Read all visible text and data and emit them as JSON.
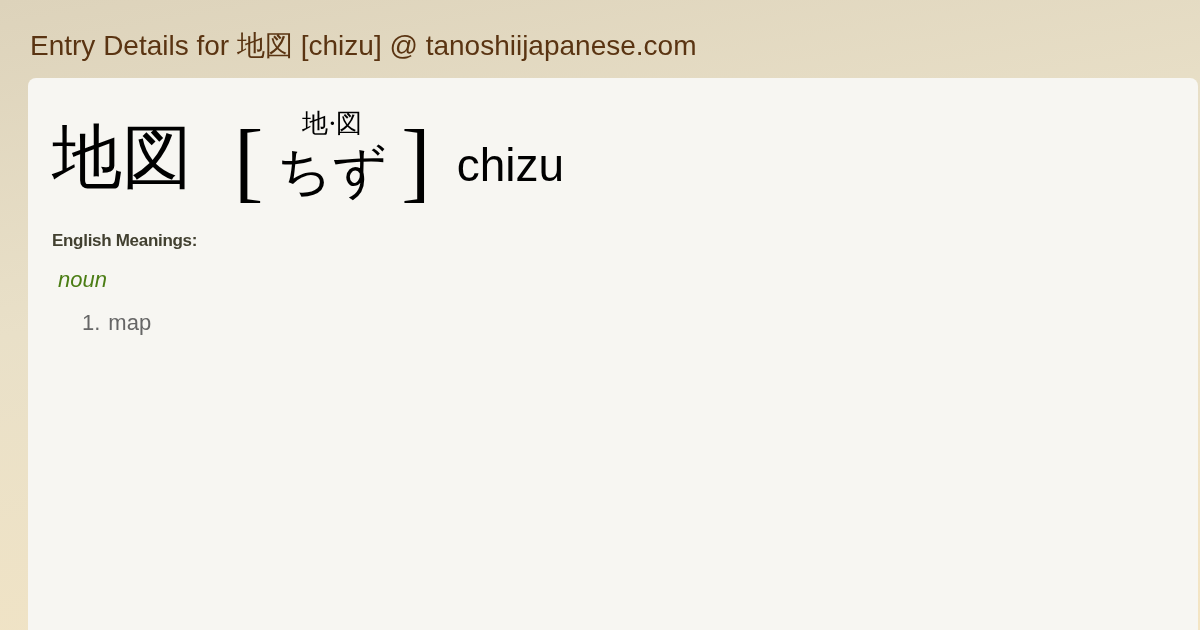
{
  "page_title": "Entry Details for 地図 [chizu] @ tanoshiijapanese.com",
  "entry": {
    "headword": "地図",
    "reading": {
      "bracket_open": "[",
      "furigana": "地·図",
      "kana": "ちず",
      "bracket_close": "]"
    },
    "romaji": "chizu"
  },
  "meanings": {
    "heading": "English Meanings:",
    "groups": [
      {
        "part_of_speech": "noun",
        "senses": [
          {
            "number": "1.",
            "text": "map"
          }
        ]
      }
    ]
  }
}
